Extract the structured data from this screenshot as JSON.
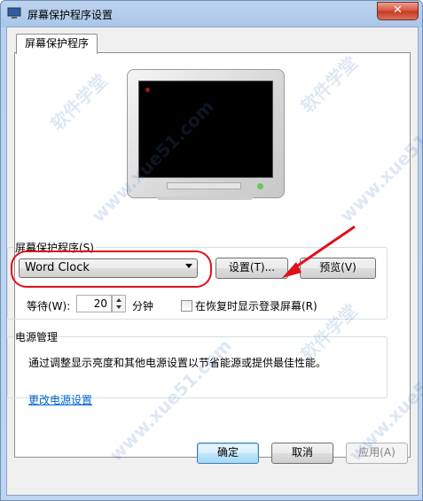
{
  "window": {
    "title": "屏幕保护程序设置",
    "close_label": "✕"
  },
  "tab": {
    "label": "屏幕保护程序"
  },
  "screensaver": {
    "group_label": "屏幕保护程序(S)",
    "selected": "Word Clock",
    "settings_label": "设置(T)...",
    "preview_label": "预览(V)",
    "wait_label": "等待(W):",
    "wait_value": "20",
    "minutes_label": "分钟",
    "resume_label": "在恢复时显示登录屏幕(R)",
    "resume_checked": false
  },
  "power": {
    "group_label": "电源管理",
    "description": "通过调整显示亮度和其他电源设置以节省能源或提供最佳性能。",
    "link_label": "更改电源设置"
  },
  "footer": {
    "ok_label": "确定",
    "cancel_label": "取消",
    "apply_label": "应用(A)"
  },
  "watermark": {
    "text_a": "软件学堂",
    "text_b": "www.xue51.com"
  },
  "colors": {
    "annotation_red": "#e0101a",
    "link_blue": "#0066cc"
  },
  "icons": [
    "monitor-icon",
    "close-icon",
    "chevron-down-icon",
    "spin-up-icon",
    "spin-down-icon"
  ]
}
